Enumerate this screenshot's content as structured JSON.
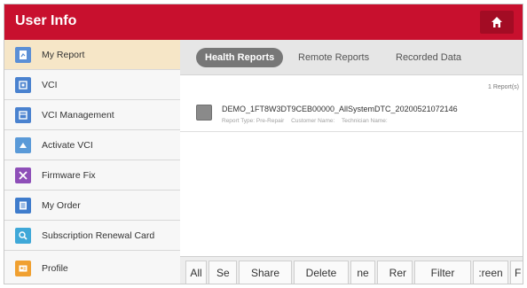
{
  "header": {
    "title": "User Info",
    "home_icon": "home-icon"
  },
  "colors": {
    "brand": "#c8102e",
    "active_item_bg": "#f6e6c7",
    "active_tab_bg": "#777777"
  },
  "sidebar": {
    "items": [
      {
        "label": "My Report",
        "icon": "report-icon",
        "active": true
      },
      {
        "label": "VCI",
        "icon": "vci-icon",
        "active": false
      },
      {
        "label": "VCI Management",
        "icon": "vci-management-icon",
        "active": false
      },
      {
        "label": "Activate VCI",
        "icon": "activate-vci-icon",
        "active": false
      },
      {
        "label": "Firmware Fix",
        "icon": "firmware-fix-icon",
        "active": false
      },
      {
        "label": "My Order",
        "icon": "order-icon",
        "active": false
      },
      {
        "label": "Subscription Renewal Card",
        "icon": "subscription-card-icon",
        "active": false
      },
      {
        "label": "Profile",
        "icon": "profile-icon",
        "active": false
      }
    ]
  },
  "tabs": [
    {
      "label": "Health Reports",
      "active": true
    },
    {
      "label": "Remote Reports",
      "active": false
    },
    {
      "label": "Recorded Data",
      "active": false
    }
  ],
  "reports": {
    "count_label": "1 Report(s)",
    "items": [
      {
        "name": "DEMO_1FT8W3DT9CEB00000_AllSystemDTC_20200521072146",
        "report_type": "Report Type: Pre-Repair",
        "customer_name": "Customer Name:",
        "technician_name": "Technician Name:"
      }
    ]
  },
  "toolbar": {
    "buttons": [
      "All",
      "Se",
      "Share",
      "Delete",
      "ne",
      "Rer",
      "Filter",
      ":reen",
      "F"
    ]
  }
}
